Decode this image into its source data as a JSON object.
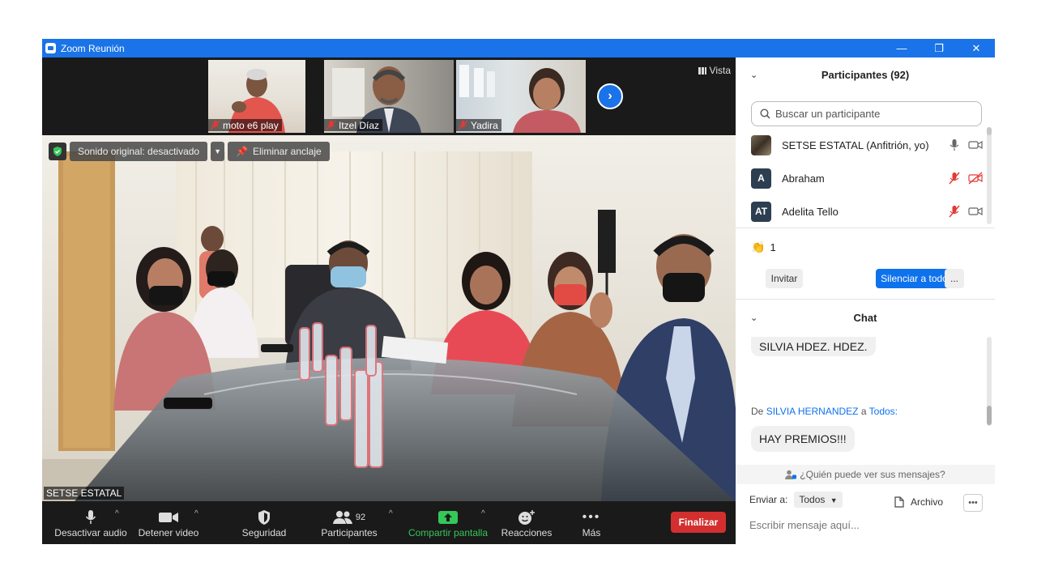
{
  "window": {
    "title": "Zoom Reunión",
    "controls": {
      "minimize": "—",
      "restore": "❐",
      "close": "✕"
    }
  },
  "gallery": {
    "thumbnails": [
      {
        "name": "moto e6 play",
        "muted": true
      },
      {
        "name": "Itzel Díaz",
        "muted": true
      },
      {
        "name": "Yadira",
        "muted": true
      }
    ],
    "next_icon": "chevron-right-icon",
    "view_label": "Vista"
  },
  "main_video": {
    "original_sound": "Sonido original: desactivado",
    "unpin": "Eliminar anclaje",
    "speaker_name": "SETSE ESTATAL"
  },
  "toolbar": {
    "audio": "Desactivar audio",
    "video": "Detener video",
    "security": "Seguridad",
    "participants": "Participantes",
    "participants_count": "92",
    "share": "Compartir pantalla",
    "reactions": "Reacciones",
    "more": "Más",
    "end": "Finalizar"
  },
  "participants_panel": {
    "header": "Participantes (92)",
    "search_placeholder": "Buscar un participante",
    "list": [
      {
        "name": "SETSE ESTATAL (Anfitrión, yo)",
        "avatar": "",
        "mic": "on",
        "video": "on"
      },
      {
        "name": "Abraham",
        "avatar": "A",
        "mic": "off",
        "video": "off"
      },
      {
        "name": "Adelita Tello",
        "avatar": "AT",
        "mic": "off",
        "video": "on"
      }
    ],
    "reaction_count": "1",
    "invite": "Invitar",
    "mute_all": "Silenciar a todos",
    "more": "..."
  },
  "chat": {
    "header": "Chat",
    "prev_message": "SILVIA HDEZ. HDEZ.",
    "from_prefix": "De",
    "from_user": "SILVIA HERNANDEZ",
    "to_word": "a",
    "to_target": "Todos:",
    "message": "HAY PREMIOS!!!",
    "who_can_see": "¿Quién puede ver sus mensajes?",
    "send_to_label": "Enviar a:",
    "send_to_value": "Todos",
    "file": "Archivo",
    "input_placeholder": "Escribir mensaje aquí..."
  },
  "colors": {
    "zoom_blue": "#1a73e8",
    "end_red": "#d32f2f",
    "share_green": "#34c759",
    "toolbar_bg": "#1a1a1a"
  }
}
